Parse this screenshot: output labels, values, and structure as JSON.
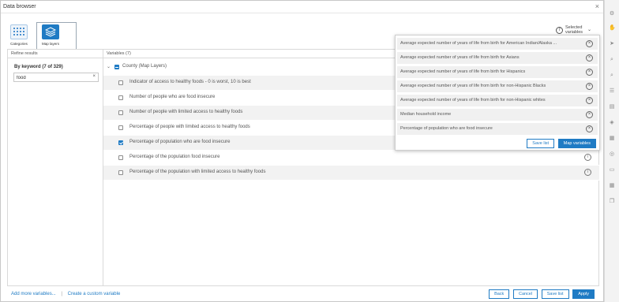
{
  "dialog": {
    "title": "Data browser",
    "close_glyph": "×"
  },
  "tabs": [
    {
      "label": "Categories",
      "icon": "grid-icon"
    },
    {
      "label": "Map layers",
      "icon": "layers-icon",
      "active": true
    }
  ],
  "refine": {
    "header": "Refine results",
    "keyword_label": "By keyword (7 of 329)",
    "search_value": "food",
    "clear_glyph": "×"
  },
  "variables": {
    "header": "Variables (7)",
    "group_label": "County (Map Layers)",
    "items": [
      {
        "label": "Indicator of access to healthy foods - 0 is worst, 10 is best",
        "checked": false
      },
      {
        "label": "Number of people who are food insecure",
        "checked": false
      },
      {
        "label": "Number of people with limited access to healthy foods",
        "checked": false
      },
      {
        "label": "Percentage of people with limited access to healthy foods",
        "checked": false
      },
      {
        "label": "Percentage of population who are food insecure",
        "checked": true
      },
      {
        "label": "Percentage of the population food insecure",
        "checked": false
      },
      {
        "label": "Percentage of the population with limited access to healthy foods",
        "checked": false
      }
    ],
    "info_glyph": "i"
  },
  "selected": {
    "count": "7",
    "label_line1": "Selected",
    "label_line2": "variables",
    "chevron": "⌄",
    "items": [
      "Average expected number of years of life from birth for American Indian/Alaska ...",
      "Average expected number of years of life from birth for Asians",
      "Average expected number of years of life from birth for Hispanics",
      "Average expected number of years of life from birth for non-Hispanic Blacks",
      "Average expected number of years of life from birth for non-Hispanic whites",
      "Median household income",
      "Percentage of population who are food insecure"
    ],
    "remove_glyph": "×",
    "save_list": "Save list",
    "map_variables": "Map variables"
  },
  "footer": {
    "add_more": "Add more variables...",
    "separator": "|",
    "create_custom": "Create a custom variable",
    "back": "Back",
    "cancel": "Cancel",
    "save_list": "Save list",
    "apply": "Apply"
  },
  "side_strip_icons": [
    "gear-icon",
    "hand-icon",
    "pointer-icon",
    "search-icon",
    "search-icon",
    "list-icon",
    "chart-icon",
    "tag-icon",
    "chart-icon",
    "target-icon",
    "car-icon",
    "table-icon",
    "copy-icon"
  ],
  "colors": {
    "accent": "#1f7bc4",
    "row_alt": "#f2f2f2",
    "selected_item_bg": "#f0f0f0"
  }
}
